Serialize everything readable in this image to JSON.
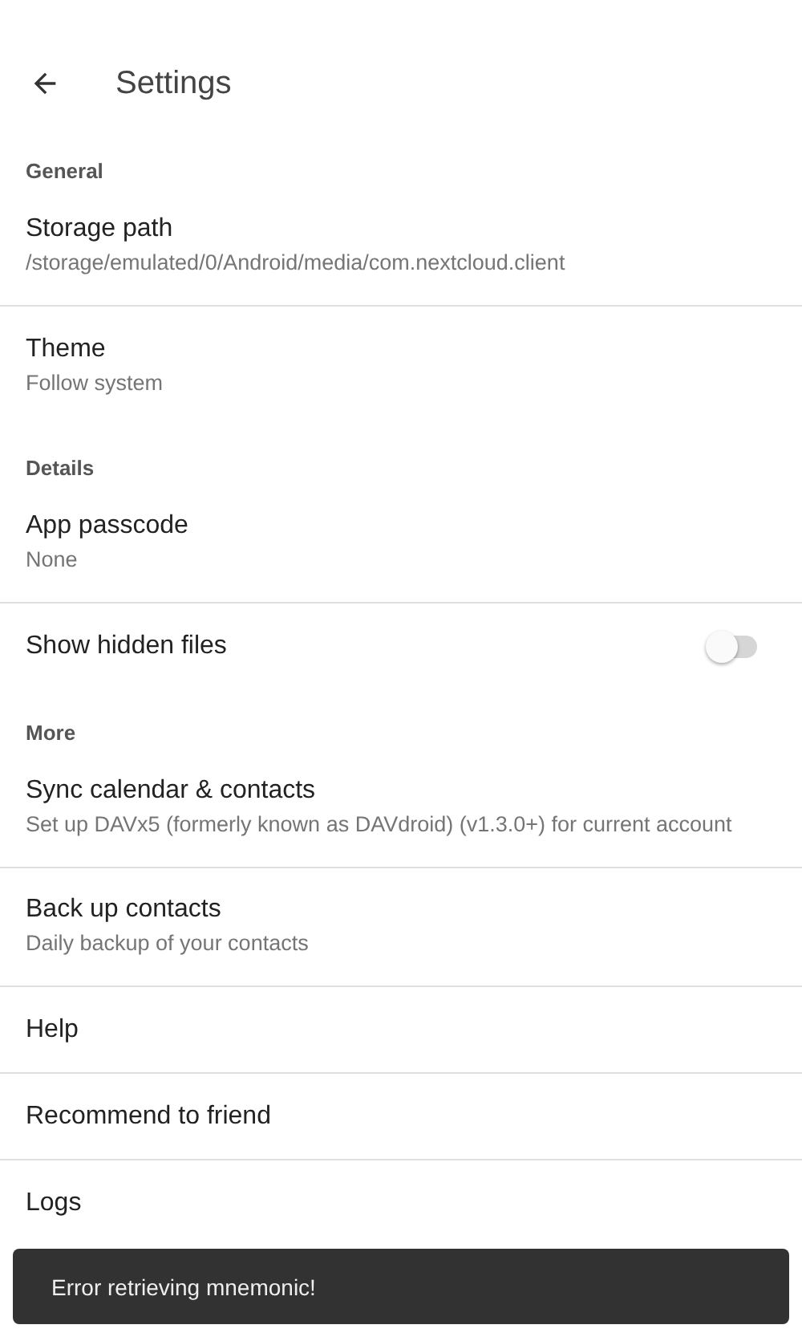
{
  "toolbar": {
    "title": "Settings"
  },
  "sections": [
    {
      "header": "General",
      "items": [
        {
          "kind": "pref",
          "title": "Storage path",
          "summary": "/storage/emulated/0/Android/media/com.nextcloud.client",
          "divider": true
        },
        {
          "kind": "pref",
          "title": "Theme",
          "summary": "Follow system",
          "divider": false
        }
      ]
    },
    {
      "header": "Details",
      "items": [
        {
          "kind": "pref",
          "title": "App passcode",
          "summary": "None",
          "divider": true
        },
        {
          "kind": "switch",
          "title": "Show hidden files",
          "on": false,
          "divider": false
        }
      ]
    },
    {
      "header": "More",
      "items": [
        {
          "kind": "pref",
          "title": "Sync calendar & contacts",
          "summary": "Set up DAVx5 (formerly known as DAVdroid) (v1.3.0+) for current account",
          "divider": true
        },
        {
          "kind": "pref",
          "title": "Back up contacts",
          "summary": "Daily backup of your contacts",
          "divider": true
        },
        {
          "kind": "pref",
          "title": "Help",
          "divider": true
        },
        {
          "kind": "pref",
          "title": "Recommend to friend",
          "divider": true
        },
        {
          "kind": "pref",
          "title": "Logs",
          "divider": false
        }
      ]
    }
  ],
  "snackbar": {
    "message": "Error retrieving mnemonic!"
  }
}
